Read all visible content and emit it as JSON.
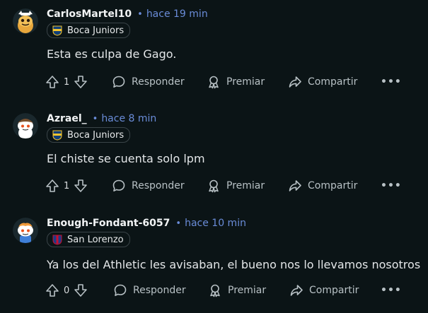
{
  "comments": [
    {
      "username": "CarlosMartel10",
      "time": "hace 19 min",
      "flair": "Boca Juniors",
      "flair_badge": "boca-juniors-badge-icon",
      "text": "Esta es culpa de Gago.",
      "votes": "1",
      "avatar_icon": "snoo-avatar-icon"
    },
    {
      "username": "Azrael_",
      "time": "hace 8 min",
      "flair": "Boca Juniors",
      "flair_badge": "boca-juniors-badge-icon",
      "text": "El chiste se cuenta solo lpm",
      "votes": "1",
      "avatar_icon": "snoo-avatar-icon"
    },
    {
      "username": "Enough-Fondant-6057",
      "time": "hace 10 min",
      "flair": "San Lorenzo",
      "flair_badge": "san-lorenzo-badge-icon",
      "text": "Ya los del Athletic les avisaban, el bueno nos lo llevamos nosotros",
      "votes": "0",
      "avatar_icon": "snoo-avatar-icon"
    }
  ],
  "actions": {
    "reply_label": "Responder",
    "award_label": "Premiar",
    "share_label": "Compartir",
    "more_label": "•••"
  },
  "colors": {
    "background": "#0b1416",
    "username": "#f2f4f5",
    "timestamp": "#6a8cd8",
    "action_text": "#b8c1c5",
    "boca_blue": "#103f79",
    "boca_yellow": "#f4c430",
    "san_lorenzo_blue": "#1b3b8a",
    "san_lorenzo_red": "#c8102e"
  }
}
